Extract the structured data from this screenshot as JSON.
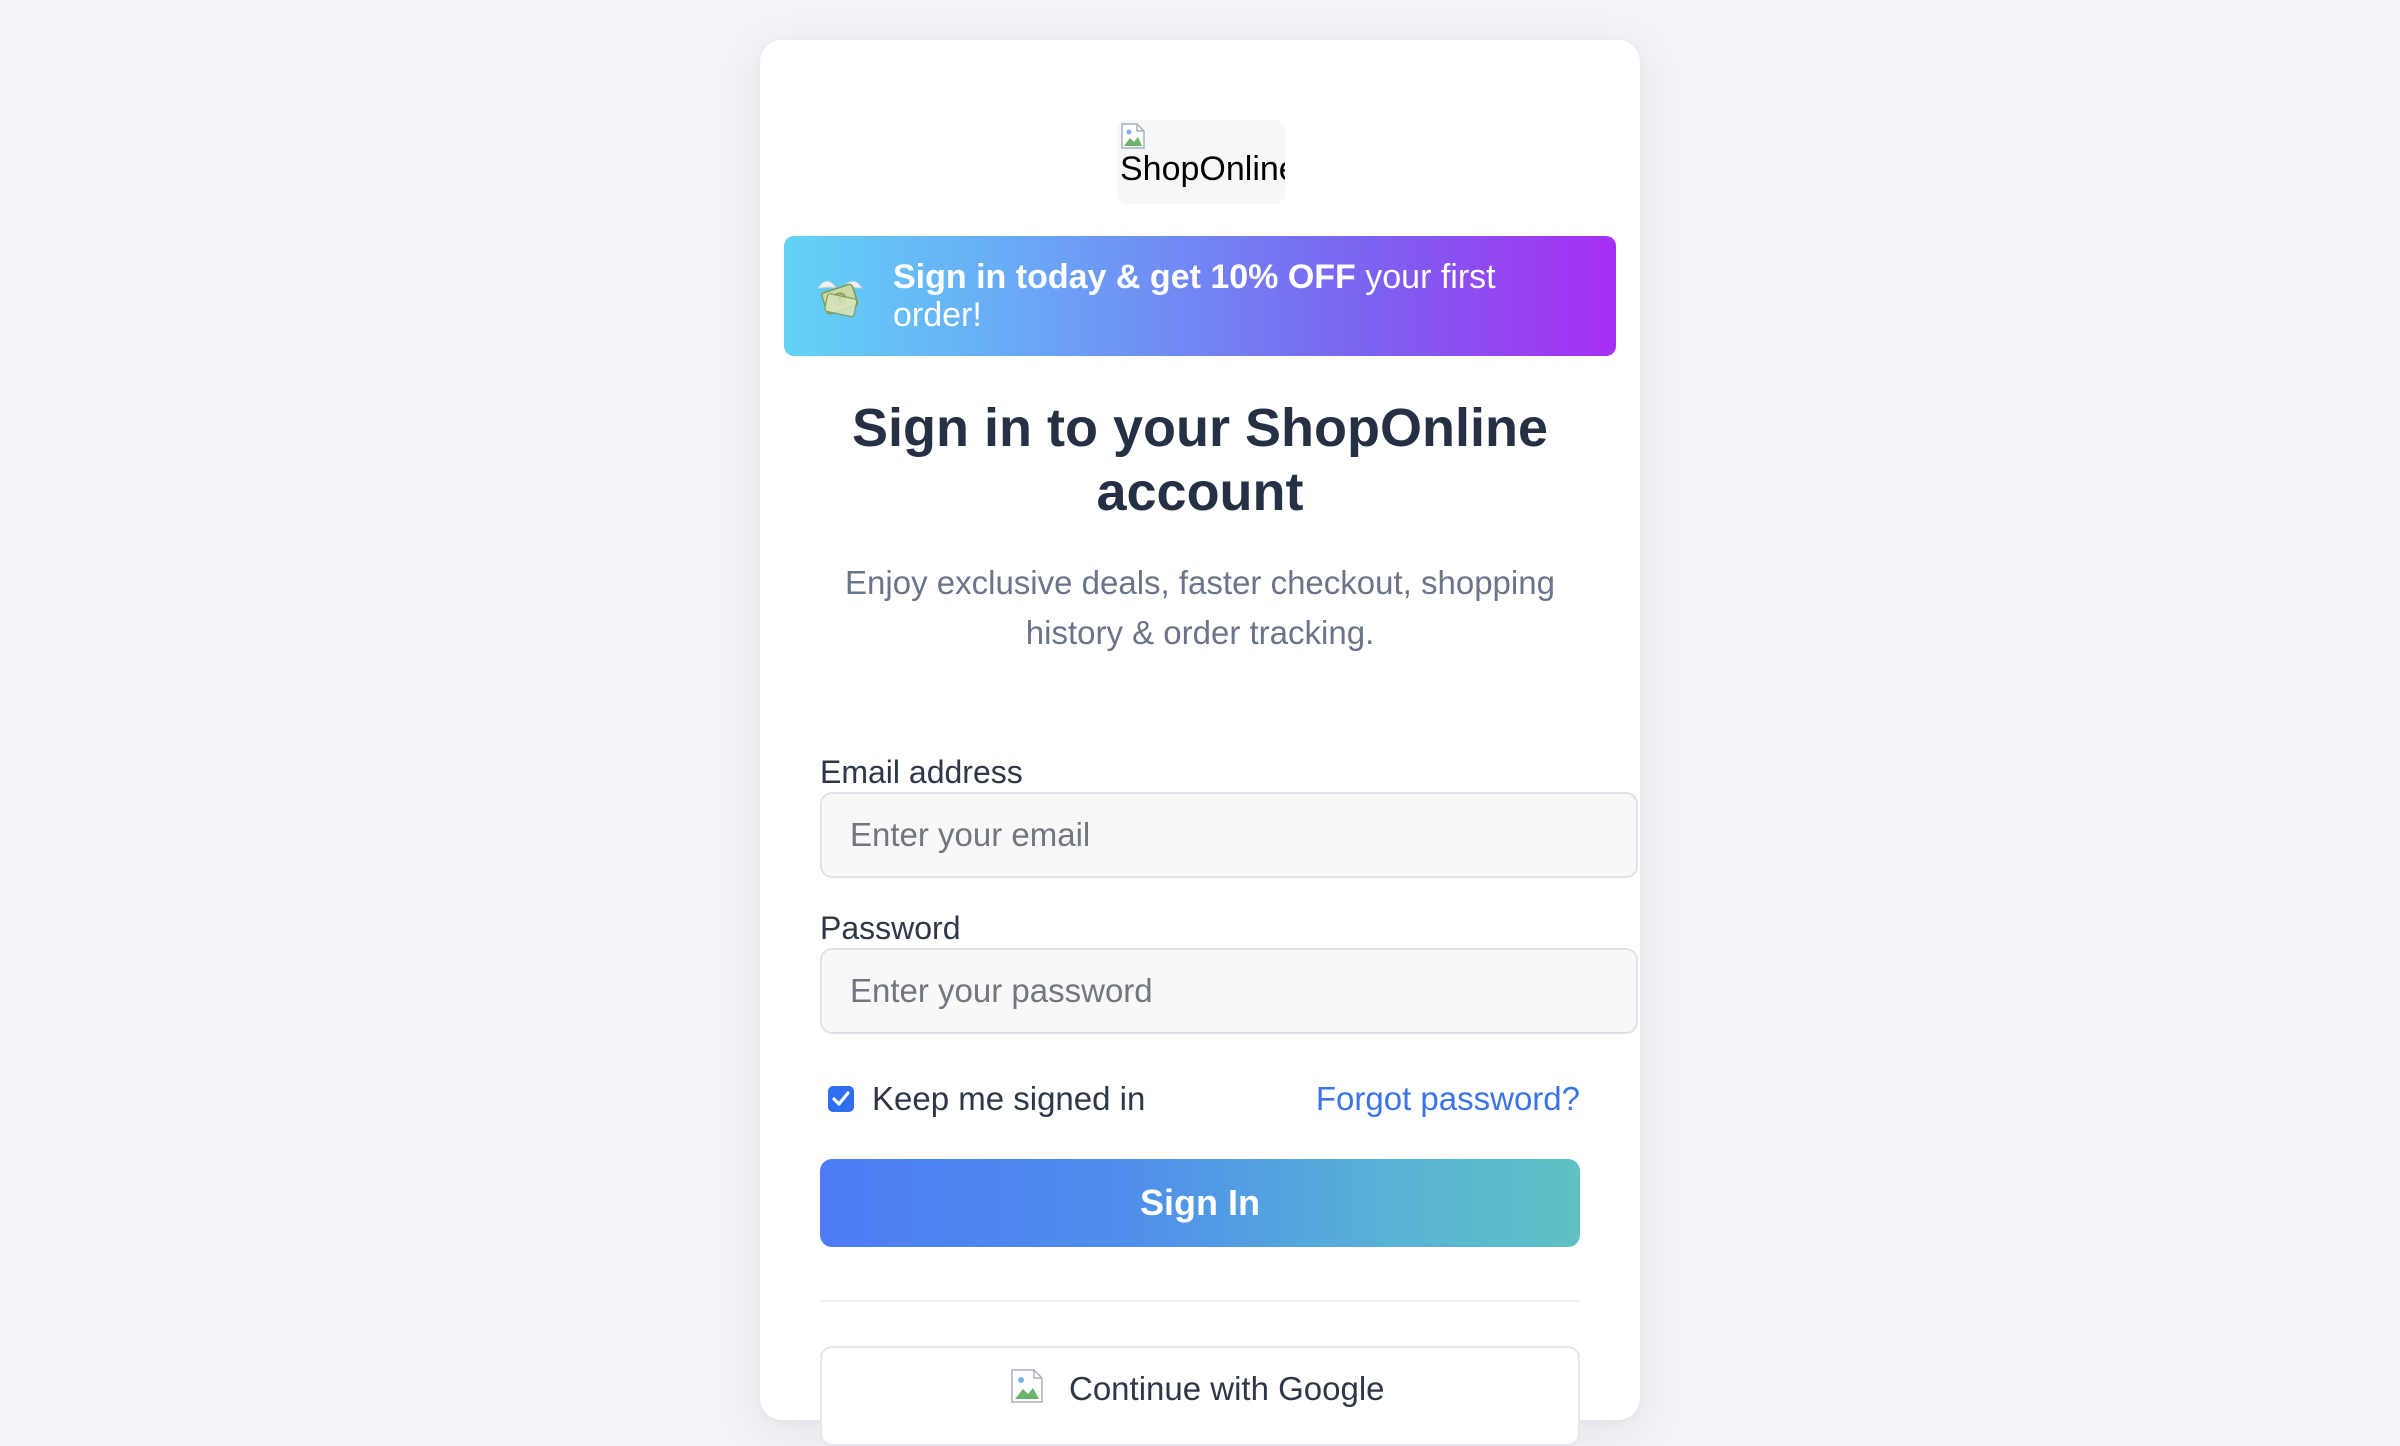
{
  "logo": {
    "alt_text": "ShopOnline Logo"
  },
  "promo": {
    "icon": "money-with-wings-icon",
    "bold_text": "Sign in today & get 10% OFF",
    "rest_text": " your first order!"
  },
  "heading": {
    "title": "Sign in to your ShopOnline account",
    "subtitle": "Enjoy exclusive deals, faster checkout, shopping history & order tracking."
  },
  "form": {
    "email": {
      "label": "Email address",
      "placeholder": "Enter your email",
      "value": ""
    },
    "password": {
      "label": "Password",
      "placeholder": "Enter your password",
      "value": ""
    },
    "keep_signed_in": {
      "label": "Keep me signed in",
      "checked": true
    },
    "forgot_link": "Forgot password?",
    "submit_label": "Sign In"
  },
  "social": {
    "google_label": "Continue with Google",
    "google_icon": "google-icon"
  },
  "colors": {
    "page_background": "#f3f4f7",
    "heading_text": "#253044",
    "muted_text": "#6b7589",
    "link": "#3b74ea",
    "checkbox_accent": "#2f6ef0",
    "promo_gradient_start": "#61d3f6",
    "promo_gradient_end": "#a62ef2",
    "button_gradient_start": "#4d7bf4",
    "button_gradient_end": "#5ec1c3"
  }
}
